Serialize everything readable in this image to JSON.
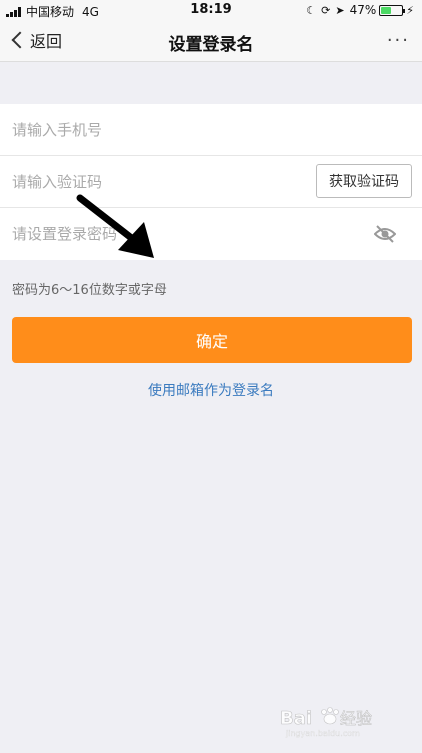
{
  "status_bar": {
    "carrier": "中国移动",
    "network": "4G",
    "time": "18:19",
    "battery_percent": "47%",
    "battery_level": 0.47,
    "icons": [
      "moon-icon",
      "rotation-lock-icon",
      "location-icon",
      "charging-icon"
    ]
  },
  "nav": {
    "back_label": "返回",
    "title": "设置登录名",
    "more_label": "···"
  },
  "form": {
    "phone_placeholder": "请输入手机号",
    "code_placeholder": "请输入验证码",
    "get_code_label": "获取验证码",
    "password_placeholder": "请设置登录密码"
  },
  "hint": "密码为6～16位数字或字母",
  "confirm_label": "确定",
  "email_link": "使用邮箱作为登录名",
  "watermark": {
    "logo_text": "Bai经验",
    "url": "jingyan.baidu.com"
  },
  "colors": {
    "accent": "#ff8d1a",
    "link": "#3b7bbf",
    "background": "#efeff4",
    "battery": "#4cd964"
  }
}
